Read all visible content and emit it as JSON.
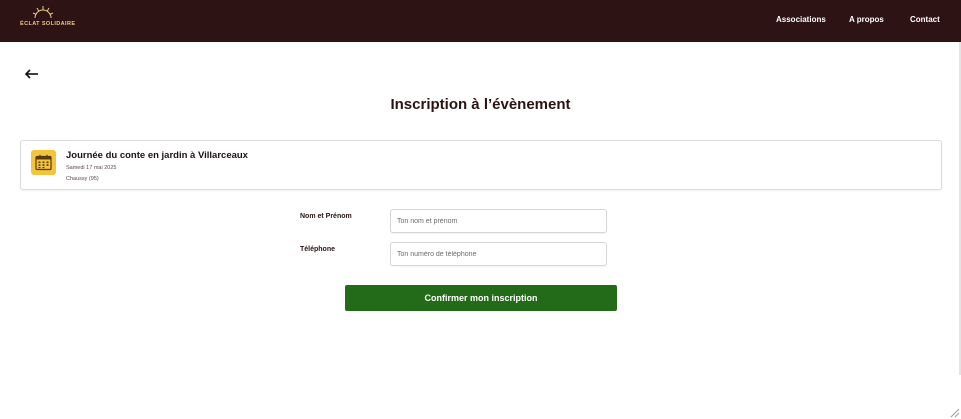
{
  "header": {
    "logo_text": "ÉCLAT SOLIDAIRE",
    "nav": {
      "associations": "Associations",
      "apropos": "A propos",
      "contact": "Contact"
    }
  },
  "page": {
    "title": "Inscription à l’évènement"
  },
  "event": {
    "title": "Journée du conte en jardin à Villarceaux",
    "date": "Samedi 17 mai 2025",
    "place": "Chaussy (95)"
  },
  "form": {
    "name_label": "Nom et Prénom",
    "name_placeholder": "Ton nom et prénom",
    "phone_label": "Téléphone",
    "phone_placeholder": "Ton numéro de téléphone",
    "submit_label": "Confirmer mon inscription"
  },
  "colors": {
    "header_bg": "#2d1314",
    "accent_yellow": "#f2c53d",
    "submit_green": "#236b18"
  }
}
